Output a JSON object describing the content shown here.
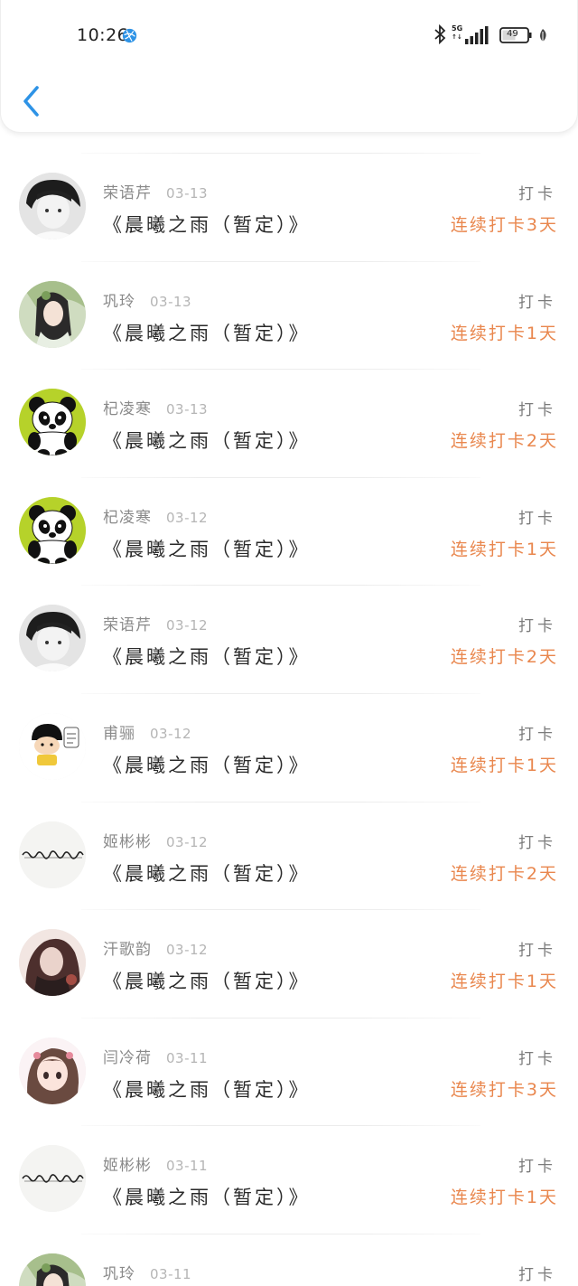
{
  "status_bar": {
    "time": "10:26",
    "network": "5G",
    "battery": "49"
  },
  "nav": {
    "back_icon": "chevron-left-icon"
  },
  "colors": {
    "accent_blue": "#2e93e6",
    "streak_orange": "#e9874e"
  },
  "items": [
    {
      "name": "荣语芹",
      "date": "03-13",
      "title": "《晨曦之雨（暂定）》",
      "label": "打卡",
      "streak": "连续打卡3天",
      "avatar": "boy-bw"
    },
    {
      "name": "巩玲",
      "date": "03-13",
      "title": "《晨曦之雨（暂定）》",
      "label": "打卡",
      "streak": "连续打卡1天",
      "avatar": "girl-costume"
    },
    {
      "name": "杞凌寒",
      "date": "03-13",
      "title": "《晨曦之雨（暂定）》",
      "label": "打卡",
      "streak": "连续打卡2天",
      "avatar": "panda"
    },
    {
      "name": "杞凌寒",
      "date": "03-12",
      "title": "《晨曦之雨（暂定）》",
      "label": "打卡",
      "streak": "连续打卡1天",
      "avatar": "panda"
    },
    {
      "name": "荣语芹",
      "date": "03-12",
      "title": "《晨曦之雨（暂定）》",
      "label": "打卡",
      "streak": "连续打卡2天",
      "avatar": "boy-bw"
    },
    {
      "name": "甫骊",
      "date": "03-12",
      "title": "《晨曦之雨（暂定）》",
      "label": "打卡",
      "streak": "连续打卡1天",
      "avatar": "cartoon-kid"
    },
    {
      "name": "姬彬彬",
      "date": "03-12",
      "title": "《晨曦之雨（暂定）》",
      "label": "打卡",
      "streak": "连续打卡2天",
      "avatar": "calligraphy"
    },
    {
      "name": "汗歌韵",
      "date": "03-12",
      "title": "《晨曦之雨（暂定）》",
      "label": "打卡",
      "streak": "连续打卡1天",
      "avatar": "girl-photo"
    },
    {
      "name": "闫冷荷",
      "date": "03-11",
      "title": "《晨曦之雨（暂定）》",
      "label": "打卡",
      "streak": "连续打卡3天",
      "avatar": "anime-girl"
    },
    {
      "name": "姬彬彬",
      "date": "03-11",
      "title": "《晨曦之雨（暂定）》",
      "label": "打卡",
      "streak": "连续打卡1天",
      "avatar": "calligraphy"
    },
    {
      "name": "巩玲",
      "date": "03-11",
      "title": "",
      "label": "打卡",
      "streak": "",
      "avatar": "girl-costume"
    }
  ]
}
